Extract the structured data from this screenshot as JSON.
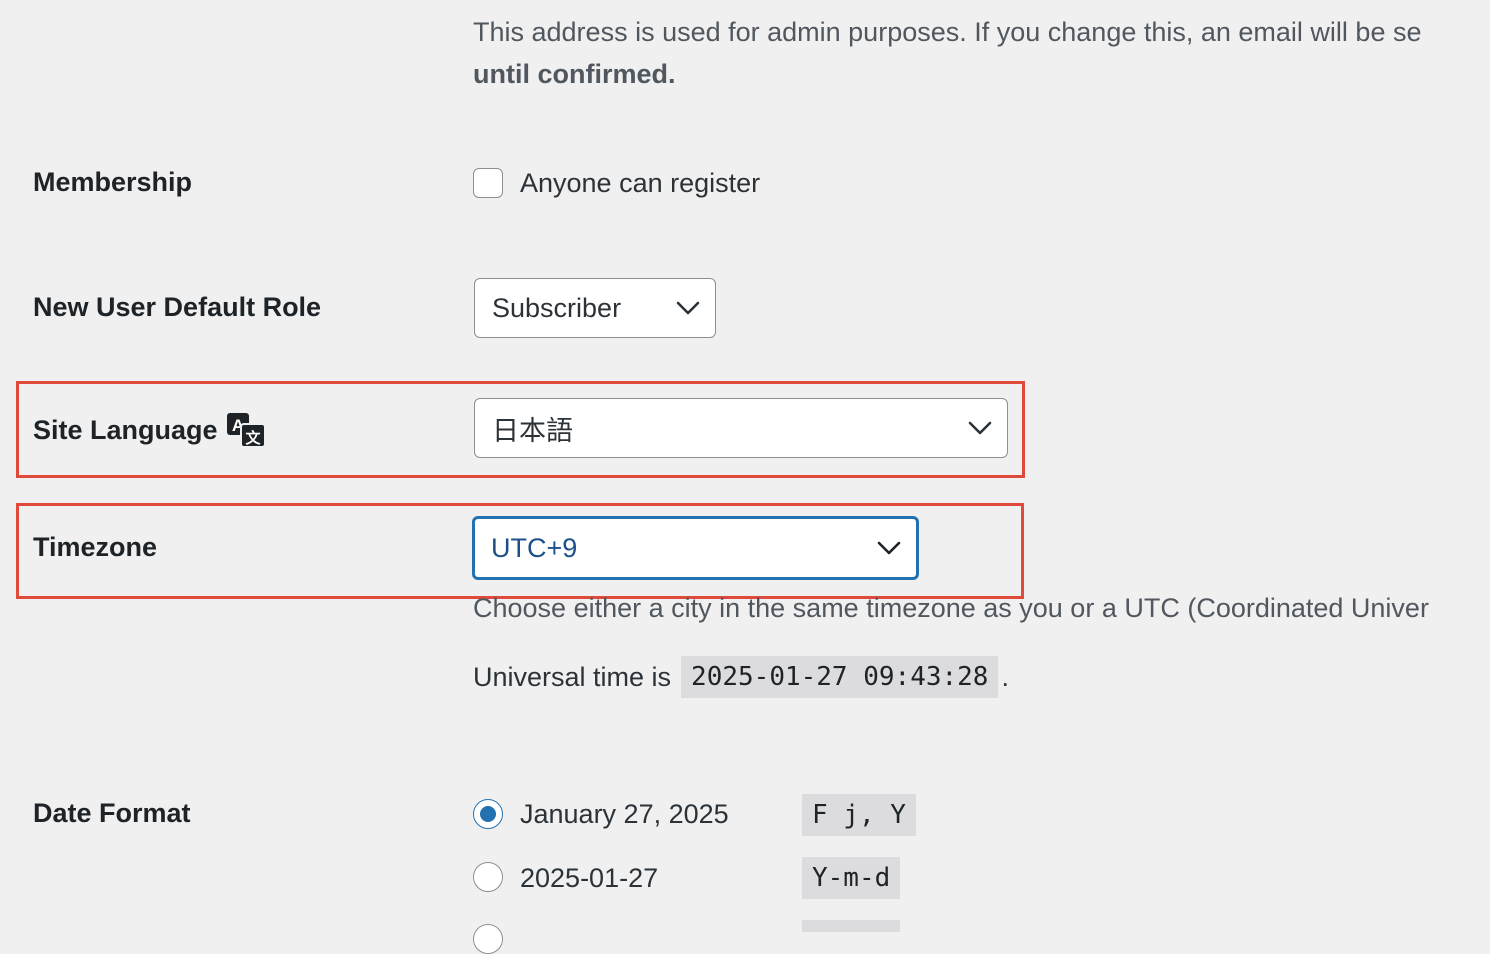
{
  "email": {
    "description_line1": "This address is used for admin purposes. If you change this, an email will be se",
    "description_line2": "until confirmed."
  },
  "membership": {
    "label": "Membership",
    "checkbox_label": "Anyone can register",
    "checked": false
  },
  "default_role": {
    "label": "New User Default Role",
    "selected": "Subscriber"
  },
  "site_language": {
    "label": "Site Language",
    "icon": "translate-icon",
    "selected": "日本語"
  },
  "timezone": {
    "label": "Timezone",
    "selected": "UTC+9",
    "description": "Choose either a city in the same timezone as you or a UTC (Coordinated Univer",
    "universal_time_prefix": "Universal time is",
    "universal_time_value": "2025-01-27 09:43:28",
    "universal_time_suffix": "."
  },
  "date_format": {
    "label": "Date Format",
    "options": [
      {
        "label": "January 27, 2025",
        "code": "F j, Y",
        "checked": true
      },
      {
        "label": "2025-01-27",
        "code": "Y-m-d",
        "checked": false
      }
    ]
  },
  "colors": {
    "highlight": "#e04a3a",
    "accent": "#2271b1"
  }
}
